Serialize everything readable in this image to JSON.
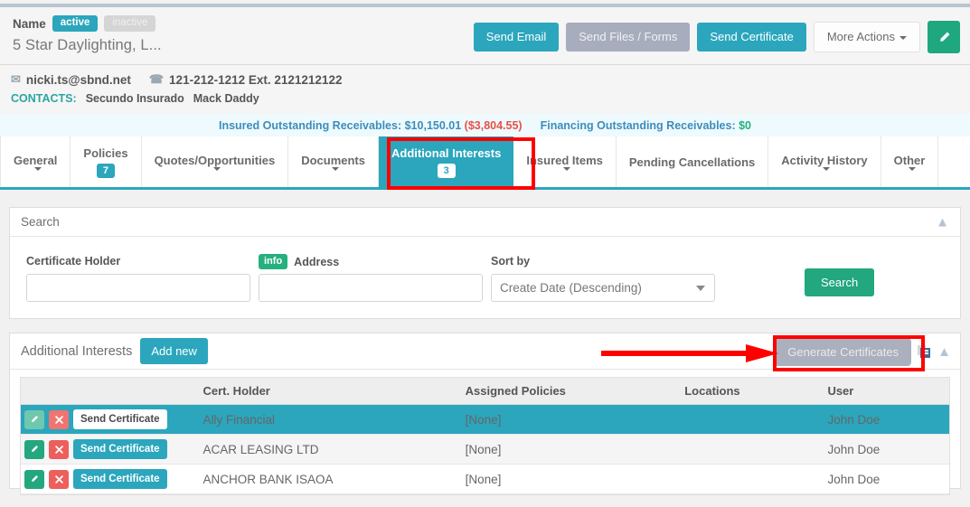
{
  "header": {
    "name_label": "Name",
    "status_active": "active",
    "status_inactive": "inactive",
    "account_name": "5 Star Daylighting, L...",
    "actions": {
      "send_email": "Send Email",
      "send_files_forms": "Send Files / Forms",
      "send_certificate": "Send Certificate",
      "more_actions": "More Actions",
      "edit_icon": "pencil-icon"
    }
  },
  "contact": {
    "mail_icon": "envelope-icon",
    "email": "nicki.ts@sbnd.net",
    "phone_icon": "phone-icon",
    "phone": "121-212-1212 Ext. 2121212122",
    "contacts_label": "CONTACTS:",
    "contact_names": [
      "Secundo Insurado",
      "Mack Daddy"
    ]
  },
  "receivables": {
    "insured_label": "Insured Outstanding Receivables:",
    "insured_amount": "$10,150.01",
    "insured_overdue": "($3,804.55)",
    "financing_label": "Financing Outstanding Receivables:",
    "financing_amount": "$0"
  },
  "tabs": [
    {
      "label": "General",
      "caret": true,
      "badge": null,
      "active": false
    },
    {
      "label": "Policies",
      "caret": false,
      "badge": "7",
      "active": false
    },
    {
      "label": "Quotes/Opportunities",
      "caret": true,
      "badge": null,
      "active": false
    },
    {
      "label": "Documents",
      "caret": true,
      "badge": null,
      "active": false
    },
    {
      "label": "Additional Interests",
      "caret": false,
      "badge": "3",
      "active": true
    },
    {
      "label": "Insured Items",
      "caret": true,
      "badge": null,
      "active": false
    },
    {
      "label": "Pending Cancellations",
      "caret": false,
      "badge": null,
      "active": false
    },
    {
      "label": "Activity History",
      "caret": true,
      "badge": null,
      "active": false
    },
    {
      "label": "Other",
      "caret": true,
      "badge": null,
      "active": false
    }
  ],
  "search_panel": {
    "title": "Search",
    "collapse_icon": "chevron-up-icon",
    "certificate_holder_label": "Certificate Holder",
    "certificate_holder_value": "",
    "info_badge": "info",
    "address_label": "Address",
    "address_value": "",
    "sort_by_label": "Sort by",
    "sort_by_value": "Create Date (Descending)",
    "search_button": "Search"
  },
  "additional_interests": {
    "title": "Additional Interests",
    "add_new_button": "Add new",
    "generate_certificates_button": "Generate Certificates",
    "export_icon": "export-excel-icon",
    "collapse_icon": "chevron-up-icon",
    "columns": [
      "",
      "Cert. Holder",
      "Assigned Policies",
      "Locations",
      "User"
    ],
    "row_action_labels": {
      "edit_icon": "pencil-icon",
      "delete_icon": "close-x-icon",
      "send_certificate": "Send Certificate"
    },
    "rows": [
      {
        "holder": "Ally Financial",
        "policies": "[None]",
        "locations": "",
        "user": "John Doe",
        "selected": true
      },
      {
        "holder": "ACAR LEASING LTD",
        "policies": "[None]",
        "locations": "",
        "user": "John Doe",
        "selected": false
      },
      {
        "holder": "ANCHOR BANK ISAOA",
        "policies": "[None]",
        "locations": "",
        "user": "John Doe",
        "selected": false
      }
    ]
  },
  "annotations": {
    "tab_highlight": "red-rectangle-on-additional-interests-tab",
    "arrow": "red-arrow-pointing-to-generate-certificates",
    "button_highlight": "red-rectangle-on-generate-certificates-button"
  },
  "colors": {
    "teal": "#2ba6bd",
    "green": "#22a77e",
    "red": "#ed5f5c",
    "gray_blue": "#a7adbd",
    "annotation_red": "#ff0000"
  }
}
